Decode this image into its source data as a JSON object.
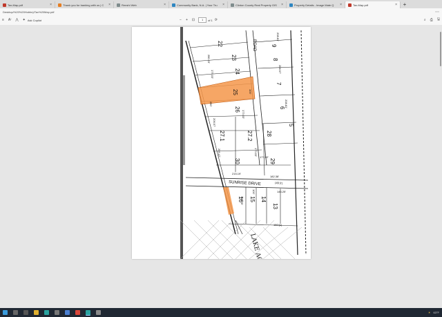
{
  "tabs": [
    {
      "title": "Tax-Map.pdf",
      "color": "#c0392b",
      "active": false
    },
    {
      "title": "Thank you for banking with us | C",
      "color": "#e67e22",
      "active": false
    },
    {
      "title": "Renshi Web",
      "color": "#7f8c8d",
      "active": false
    },
    {
      "title": "Community Bank, N.A. | Your Tru",
      "color": "#2e86c1",
      "active": false
    },
    {
      "title": "Clinton County Real Property GIS",
      "color": "#7f8c8d",
      "active": false
    },
    {
      "title": "Property Details - Image Mate Q",
      "color": "#2e86c1",
      "active": false
    },
    {
      "title": "Tax-Map.pdf",
      "color": "#c0392b",
      "active": true
    }
  ],
  "newtab_label": "+",
  "address": {
    "url": "Desktop/%20%20Hobbs)/Tax%20Map.pdf",
    "menu": "⋯"
  },
  "pdf_toolbar": {
    "menu_icon": "≡",
    "read_aloud": "A⁾",
    "draw": "⋀",
    "ask_copilot": "Ask Copilot",
    "zoom_out": "−",
    "zoom_in": "+",
    "fit": "⊡",
    "page_current": "1",
    "page_total": "of 1",
    "rotate": "⟳",
    "search": "⌕",
    "print": "⎙",
    "save": "🖫",
    "copilot_icon": "✦"
  },
  "map": {
    "road_top": "ROAD",
    "road_mid": "SUNRISE DRIVE",
    "road_mid_width": "(49.5')",
    "highlight_color": "#f5964a",
    "handwriting": "LAKE ACCESS",
    "lots": [
      {
        "id": "22"
      },
      {
        "id": "23"
      },
      {
        "id": "24"
      },
      {
        "id": "25"
      },
      {
        "id": "26"
      },
      {
        "id": "27.1"
      },
      {
        "id": "27.2"
      },
      {
        "id": "28"
      },
      {
        "id": "29"
      },
      {
        "id": "30"
      },
      {
        "id": "9"
      },
      {
        "id": "8"
      },
      {
        "id": "7"
      },
      {
        "id": "6"
      },
      {
        "id": "5"
      },
      {
        "id": "16"
      },
      {
        "id": "15"
      },
      {
        "id": "14"
      },
      {
        "id": "13"
      }
    ],
    "dims": [
      "208.81'",
      "208.97'",
      "175.03'",
      "280.03'",
      "100'",
      "208.81'",
      "173.03'",
      "280'",
      "206.97'",
      "205.47'",
      "177.92'",
      "215.19'",
      "182.38'",
      "146.25'",
      "150'(s)",
      "110.35'",
      "173.03'",
      "100'"
    ]
  },
  "taskbar": {
    "time": "63°F",
    "icons": [
      "start",
      "search",
      "taskview",
      "explorer",
      "edge",
      "store",
      "mail",
      "chrome",
      "edge2",
      "other"
    ]
  }
}
